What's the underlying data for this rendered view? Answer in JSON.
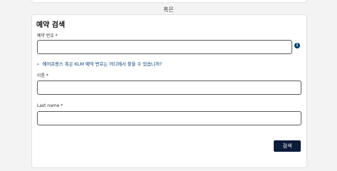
{
  "divider_text": "혹은",
  "form": {
    "title": "예약 검색",
    "booking_code": {
      "label": "예약 번호",
      "required_mark": "*",
      "value": ""
    },
    "info_icon": "i",
    "help_link": {
      "chevron": "›",
      "text": "에어프랑스 혹은 KLM 예약 번호는 어디에서 찾을 수 있습니까?"
    },
    "first_name": {
      "label": "이름",
      "required_mark": "*",
      "value": ""
    },
    "last_name": {
      "label": "Last name",
      "required_mark": "*",
      "value": ""
    },
    "search_button": "검색"
  },
  "colors": {
    "primary_navy": "#0b1b3a",
    "link_blue": "#003b73"
  }
}
